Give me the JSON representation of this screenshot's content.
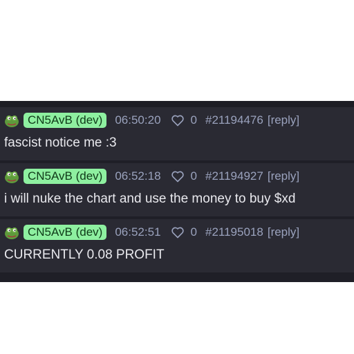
{
  "messages": [
    {
      "author": "CN5AvB (dev)",
      "time": "06:50:20",
      "likes": "0",
      "id": "#21194476",
      "reply": "[reply]",
      "text": "fascist notice me :3"
    },
    {
      "author": "CN5AvB (dev)",
      "time": "06:52:18",
      "likes": "0",
      "id": "#21194927",
      "reply": "[reply]",
      "text": "i will nuke the chart and use the money to buy $xd"
    },
    {
      "author": "CN5AvB (dev)",
      "time": "06:52:51",
      "likes": "0",
      "id": "#21195018",
      "reply": "[reply]",
      "text": "CURRENTLY 0.08 PROFIT"
    }
  ],
  "icons": {
    "avatar": "frog-avatar-icon",
    "like": "heart-outline-icon"
  },
  "colors": {
    "background": "#2a2a33",
    "dev_badge": "#8ef0a0",
    "meta_text": "#9aa2bd",
    "message_text": "#e9e9ee"
  }
}
